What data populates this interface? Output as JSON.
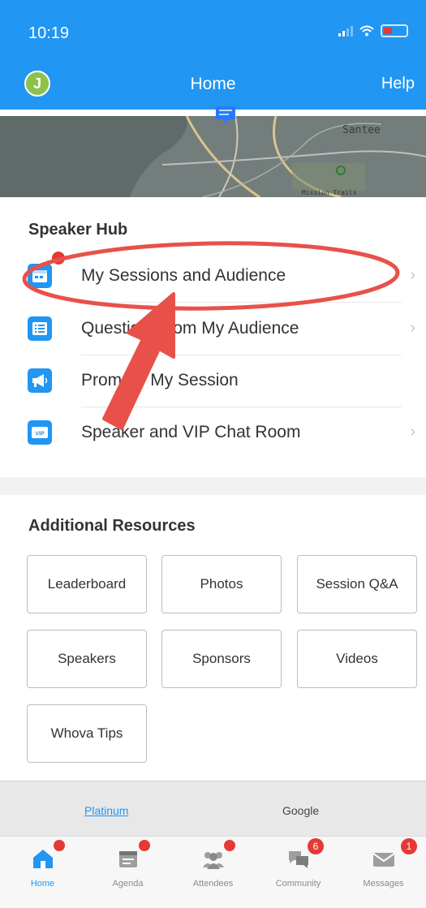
{
  "status_bar": {
    "time": "10:19"
  },
  "nav": {
    "avatar_initial": "J",
    "title": "Home",
    "help": "Help"
  },
  "map": {
    "label_town": "Santee",
    "label_trails": "Mission Trails"
  },
  "speaker_hub": {
    "title": "Speaker Hub",
    "items": [
      {
        "label": "My Sessions and Audience",
        "icon": "calendar-icon"
      },
      {
        "label": "Questions from My Audience",
        "icon": "list-icon"
      },
      {
        "label": "Promote My Session",
        "icon": "megaphone-icon"
      },
      {
        "label": "Speaker and VIP Chat Room",
        "icon": "vip-icon"
      }
    ]
  },
  "additional_resources": {
    "title": "Additional Resources",
    "buttons": [
      "Leaderboard",
      "Photos",
      "Session Q&A",
      "Speakers",
      "Sponsors",
      "Videos",
      "Whova Tips"
    ]
  },
  "ad_bar": {
    "left": "Platinum",
    "right": "Google"
  },
  "tabs": [
    {
      "label": "Home",
      "icon": "home-icon",
      "active": true,
      "badge": ""
    },
    {
      "label": "Agenda",
      "icon": "agenda-icon",
      "active": false,
      "badge": ""
    },
    {
      "label": "Attendees",
      "icon": "attendees-icon",
      "active": false,
      "badge": ""
    },
    {
      "label": "Community",
      "icon": "community-icon",
      "active": false,
      "badge": "6"
    },
    {
      "label": "Messages",
      "icon": "messages-icon",
      "active": false,
      "badge": "1"
    }
  ],
  "colors": {
    "primary": "#2196f3",
    "badge": "#e53935",
    "annotation": "#e8514a",
    "avatar": "#8bc34a"
  }
}
